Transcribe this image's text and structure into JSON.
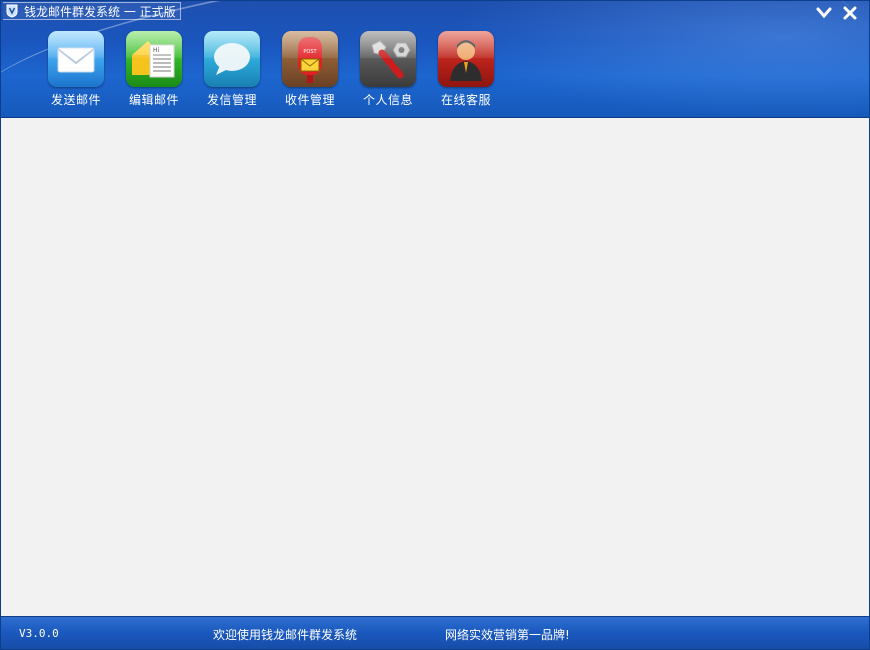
{
  "window": {
    "title": "钱龙邮件群发系统 一 正式版"
  },
  "toolbar": {
    "items": [
      {
        "label": "发送邮件",
        "icon": "envelope-icon",
        "color": "#3aa0ec"
      },
      {
        "label": "编辑邮件",
        "icon": "compose-letter-icon",
        "color": "#2fb325"
      },
      {
        "label": "发信管理",
        "icon": "speech-bubble-icon",
        "color": "#2aa7d6"
      },
      {
        "label": "收件管理",
        "icon": "mailbox-post-icon",
        "color": "#8a5a34"
      },
      {
        "label": "个人信息",
        "icon": "wrench-bolt-icon",
        "color": "#555555"
      },
      {
        "label": "在线客服",
        "icon": "support-agent-icon",
        "color": "#b8211a"
      }
    ]
  },
  "statusbar": {
    "version": "V3.0.0",
    "welcome": "欢迎使用钱龙邮件群发系统",
    "slogan": "网络实效营销第一品牌!"
  },
  "colors": {
    "header_blue": "#1a56be",
    "content_bg": "#f2f2f2"
  }
}
